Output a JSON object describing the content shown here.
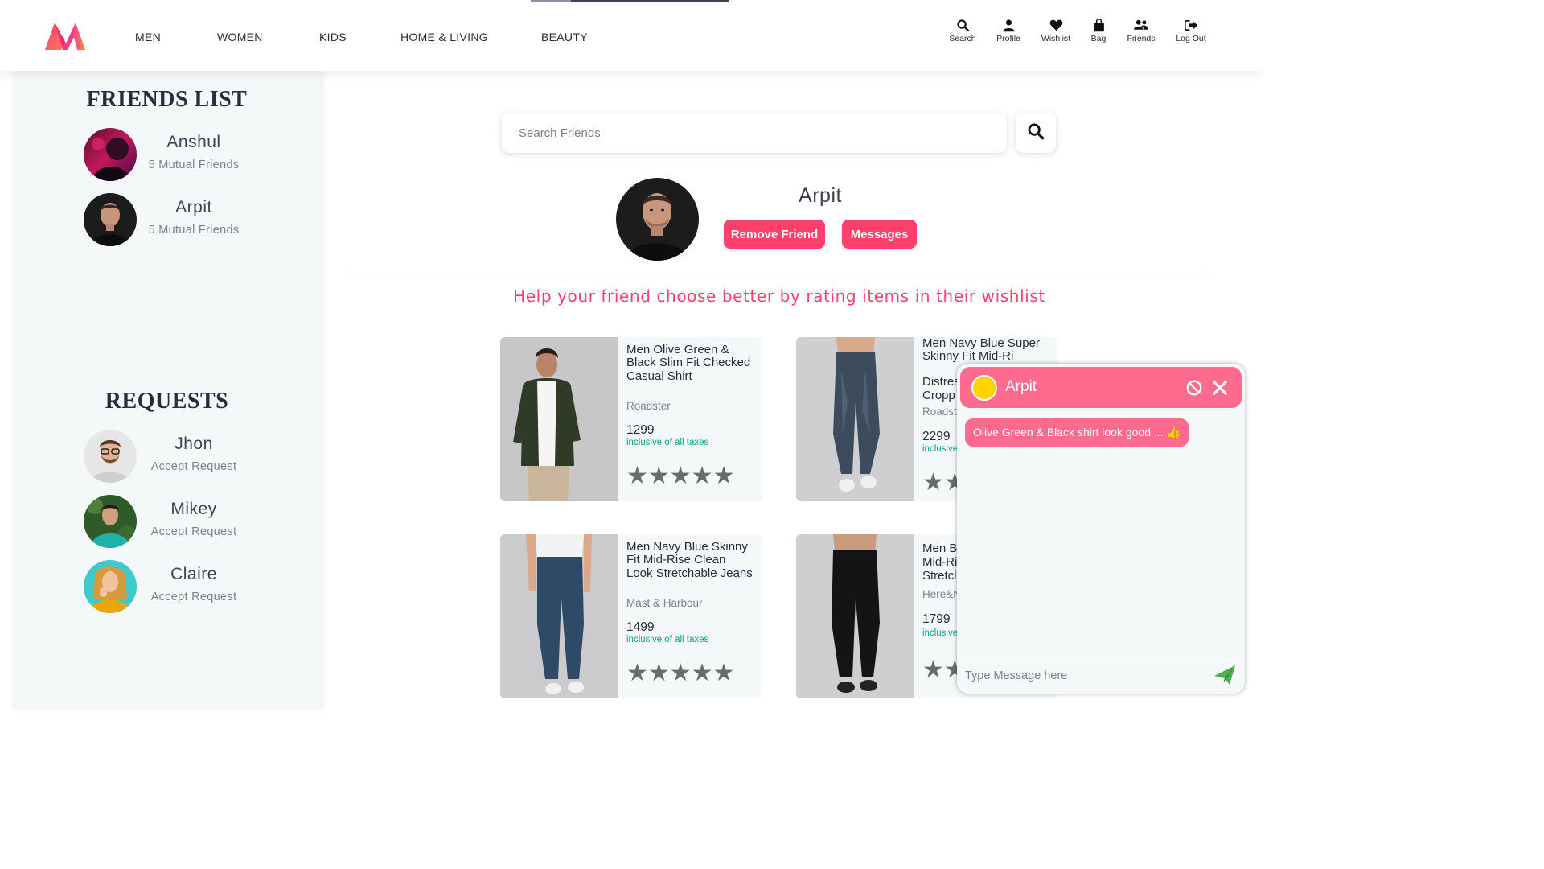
{
  "header": {
    "nav": [
      "MEN",
      "WOMEN",
      "KIDS",
      "HOME & LIVING",
      "BEAUTY"
    ],
    "actions": [
      {
        "label": "Search",
        "icon": "search-icon"
      },
      {
        "label": "Profile",
        "icon": "profile-icon"
      },
      {
        "label": "Wishlist",
        "icon": "heart-icon"
      },
      {
        "label": "Bag",
        "icon": "bag-icon"
      },
      {
        "label": "Friends",
        "icon": "friends-icon"
      },
      {
        "label": "Log Out",
        "icon": "logout-icon"
      }
    ]
  },
  "sidebar": {
    "friends_title": "FRIENDS LIST",
    "friends": [
      {
        "name": "Anshul",
        "sub": "5 Mutual Friends"
      },
      {
        "name": "Arpit",
        "sub": "5 Mutual Friends"
      }
    ],
    "requests_title": "REQUESTS",
    "requests": [
      {
        "name": "Jhon",
        "sub": "Accept Request"
      },
      {
        "name": "Mikey",
        "sub": "Accept Request"
      },
      {
        "name": "Claire",
        "sub": "Accept Request"
      }
    ]
  },
  "main": {
    "search_placeholder": "Search Friends",
    "profile": {
      "name": "Arpit",
      "remove_label": "Remove Friend",
      "messages_label": "Messages"
    },
    "help_text": "Help your friend choose better by rating items in their wishlist",
    "products": [
      {
        "title": "Men Olive Green & Black Slim Fit Checked Casual Shirt",
        "brand": "Roadster",
        "price": "1299",
        "tax": "inclusive of all taxes",
        "stars": "★★★★★",
        "rating": 0
      },
      {
        "title": "Men Navy Blue Super Skinny Fit Mid-Ri",
        "title_line4": "Distres",
        "title_line5": "Cropp",
        "brand": "Roadste",
        "price": "2299",
        "tax": "inclusive",
        "stars": "★★",
        "rating": 0
      },
      {
        "title": "Men Navy Blue Skinny Fit Mid-Rise Clean Look Stretchable Jeans",
        "brand": "Mast & Harbour",
        "price": "1499",
        "tax": "inclusive of all taxes",
        "stars": "★★★★★",
        "rating": 0
      },
      {
        "title": "Men B",
        "title_line2": "Mid-Ri",
        "title_line3": "Stretcl",
        "brand": "Here&N",
        "price": "1799",
        "tax": "inclusive",
        "stars": "★★",
        "rating": 0
      }
    ]
  },
  "chat": {
    "name": "Arpit",
    "message": "Olive Green & Black shirt look good ... 👍",
    "input_placeholder": "Type Message here"
  },
  "colors": {
    "accent": "#ff3f6c",
    "chat_header": "#ff6b8f",
    "status_dot": "#ffd400",
    "tax_green": "#03a685",
    "send_green": "#4caf50"
  }
}
